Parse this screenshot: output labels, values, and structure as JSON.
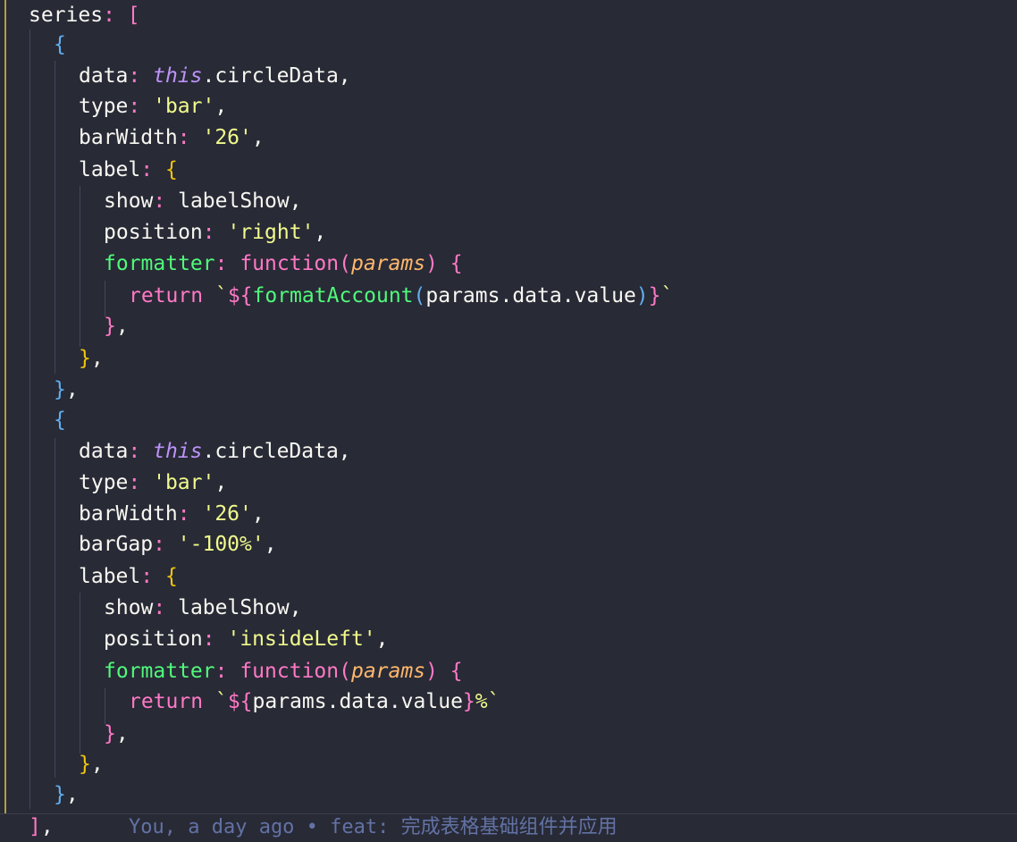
{
  "code": {
    "l1_key": "series",
    "l1_open": "[",
    "l2_open": "{",
    "data_key": "data",
    "this_kw": "this",
    "circle_data": ".circleData,",
    "type_key": "type",
    "bar_str": "'bar'",
    "comma": ",",
    "barwidth_key": "barWidth",
    "barwidth_val": "'26'",
    "label_key": "label",
    "brace_open": "{",
    "show_key": "show",
    "label_show": "labelShow,",
    "position_key": "position",
    "pos_right": "'right'",
    "pos_inside_left": "'insideLeft'",
    "formatter_key": "formatter",
    "function_kw": "function",
    "paren_open": "(",
    "params": "params",
    "paren_close": ")",
    "return_kw": "return",
    "tick": "`",
    "interp_open": "${",
    "format_account": "formatAccount",
    "params_value": "params.data.value",
    "interp_close": "}",
    "percent": "%",
    "brace_close_comma": "},",
    "bargap_key": "barGap",
    "bargap_val": "'-100%'",
    "close_bracket": "]",
    "colon": ": "
  },
  "blame": {
    "text": "You, a day ago • feat: 完成表格基础组件并应用"
  },
  "colors": {
    "background": "#282a36",
    "string": "#f1fa8c",
    "keyword": "#ff79c6",
    "function_key": "#50fa7b",
    "param": "#ffb86c",
    "this": "#bd93f9",
    "blame": "#6272a4"
  }
}
